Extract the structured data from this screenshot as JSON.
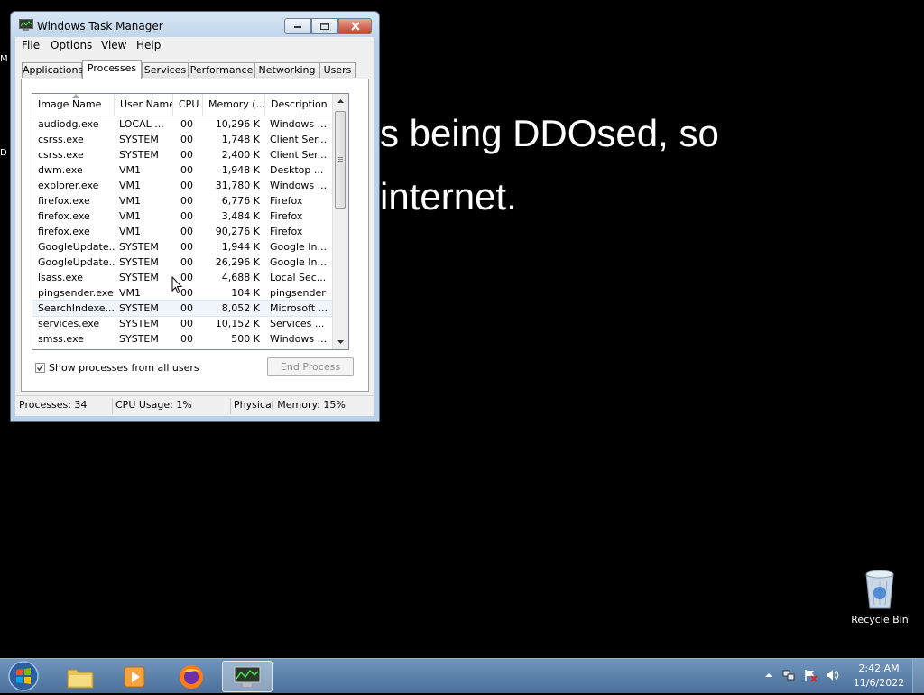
{
  "desktop": {
    "line1": "s being DDOsed, so",
    "line2": "internet.",
    "edge_m": "M",
    "edge_d": "D",
    "recycle_bin_label": "Recycle Bin"
  },
  "window": {
    "title": "Windows Task Manager",
    "menu": [
      "File",
      "Options",
      "View",
      "Help"
    ],
    "tabs": [
      "Applications",
      "Processes",
      "Services",
      "Performance",
      "Networking",
      "Users"
    ],
    "active_tab": "Processes",
    "columns": [
      "Image Name",
      "User Name",
      "CPU",
      "Memory (...",
      "Description"
    ],
    "processes": [
      {
        "image": "audiodg.exe",
        "user": "LOCAL ...",
        "cpu": "00",
        "memory": "10,296 K",
        "desc": "Windows ..."
      },
      {
        "image": "csrss.exe",
        "user": "SYSTEM",
        "cpu": "00",
        "memory": "1,748 K",
        "desc": "Client Ser..."
      },
      {
        "image": "csrss.exe",
        "user": "SYSTEM",
        "cpu": "00",
        "memory": "2,400 K",
        "desc": "Client Ser..."
      },
      {
        "image": "dwm.exe",
        "user": "VM1",
        "cpu": "00",
        "memory": "1,948 K",
        "desc": "Desktop ..."
      },
      {
        "image": "explorer.exe",
        "user": "VM1",
        "cpu": "00",
        "memory": "31,780 K",
        "desc": "Windows ..."
      },
      {
        "image": "firefox.exe",
        "user": "VM1",
        "cpu": "00",
        "memory": "6,776 K",
        "desc": "Firefox"
      },
      {
        "image": "firefox.exe",
        "user": "VM1",
        "cpu": "00",
        "memory": "3,484 K",
        "desc": "Firefox"
      },
      {
        "image": "firefox.exe",
        "user": "VM1",
        "cpu": "00",
        "memory": "90,276 K",
        "desc": "Firefox"
      },
      {
        "image": "GoogleUpdate...",
        "user": "SYSTEM",
        "cpu": "00",
        "memory": "1,944 K",
        "desc": "Google In..."
      },
      {
        "image": "GoogleUpdate...",
        "user": "SYSTEM",
        "cpu": "00",
        "memory": "26,296 K",
        "desc": "Google In..."
      },
      {
        "image": "lsass.exe",
        "user": "SYSTEM",
        "cpu": "00",
        "memory": "4,688 K",
        "desc": "Local Sec..."
      },
      {
        "image": "pingsender.exe",
        "user": "VM1",
        "cpu": "00",
        "memory": "104 K",
        "desc": "pingsender"
      },
      {
        "image": "SearchIndexe...",
        "user": "SYSTEM",
        "cpu": "00",
        "memory": "8,052 K",
        "desc": "Microsoft ..."
      },
      {
        "image": "services.exe",
        "user": "SYSTEM",
        "cpu": "00",
        "memory": "10,152 K",
        "desc": "Services ..."
      },
      {
        "image": "smss.exe",
        "user": "SYSTEM",
        "cpu": "00",
        "memory": "500 K",
        "desc": "Windows ..."
      }
    ],
    "show_all_label": "Show processes from all users",
    "show_all_checked": true,
    "end_process_label": "End Process",
    "status": {
      "processes": "Processes: 34",
      "cpu": "CPU Usage: 1%",
      "memory": "Physical Memory: 15%"
    }
  },
  "taskbar": {
    "pinned": [
      "windows-explorer-icon",
      "media-player-icon",
      "firefox-icon",
      "task-manager-icon"
    ],
    "clock_time": "2:42 AM",
    "clock_date": "11/6/2022"
  },
  "colors": {
    "titlebar": "#bfd4ea",
    "taskbar": "#5a80a8",
    "close_button": "#c4412b"
  }
}
